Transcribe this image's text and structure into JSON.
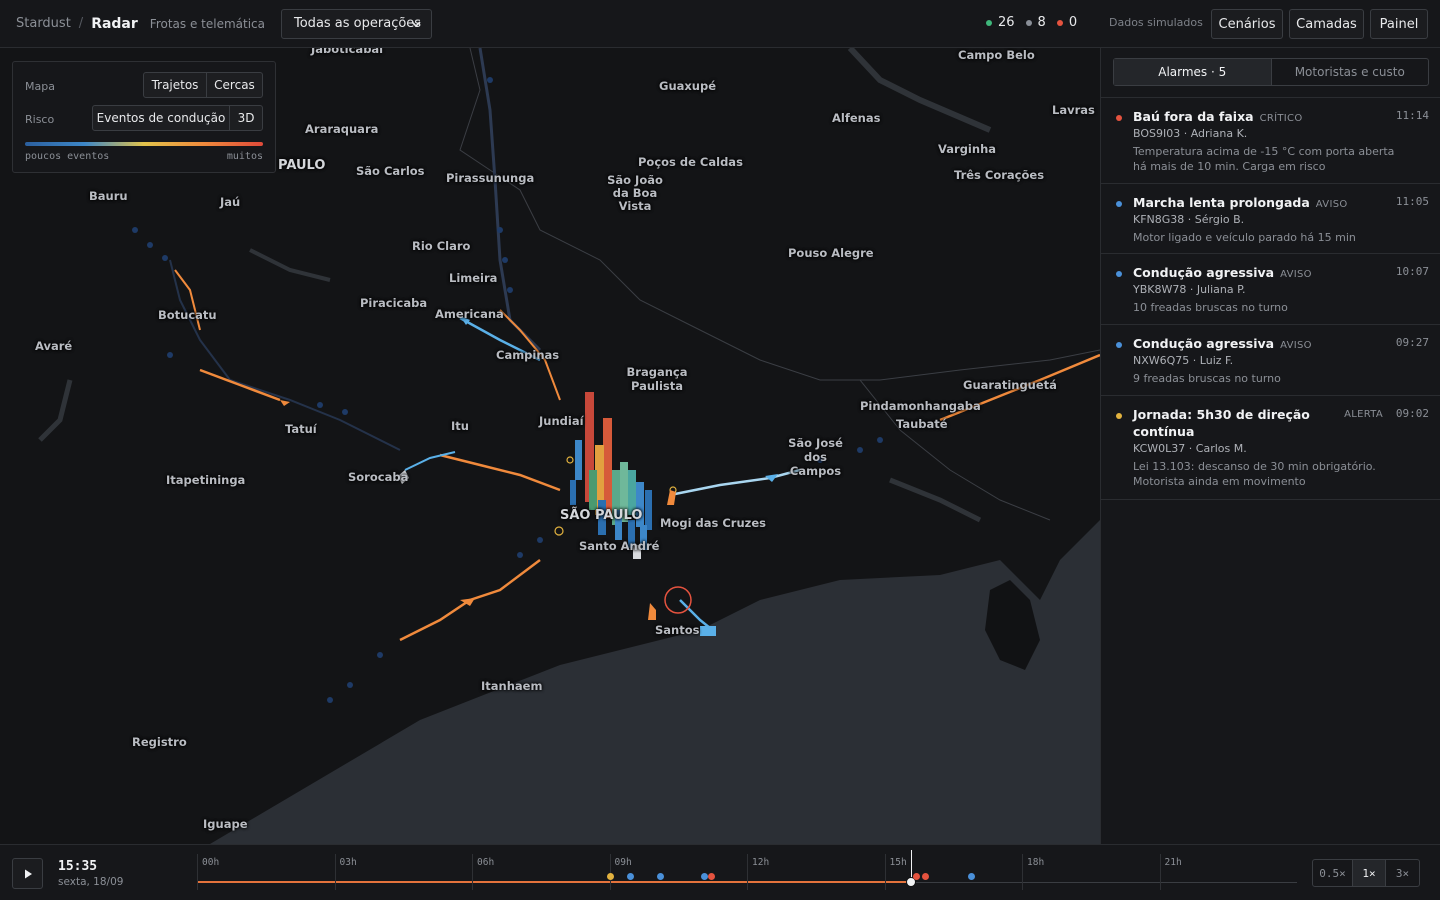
{
  "header": {
    "brand": "Stardust",
    "separator": "/",
    "app": "Radar",
    "subtitle": "Frotas e telemática",
    "operations_select": "Todas as operações",
    "counts": [
      {
        "value": "26",
        "color": "#3fb77b"
      },
      {
        "value": "8",
        "color": "#8a8f98"
      },
      {
        "value": "0",
        "color": "#e5533f"
      }
    ],
    "sim_label": "Dados simulados",
    "buttons": {
      "scenarios": "Cenários",
      "layers": "Camadas",
      "panel": "Painel"
    }
  },
  "map_panel": {
    "map_label": "Mapa",
    "map_options": [
      "Trajetos",
      "Cercas"
    ],
    "risk_label": "Risco",
    "risk_options": [
      "Eventos de condução",
      "3D"
    ],
    "scale_low": "poucos eventos",
    "scale_high": "muitos"
  },
  "cities": [
    "Jaboticabal",
    "Campo Belo",
    "Guaxupé",
    "Lavras",
    "Araraquara",
    "Alfenas",
    "PAULO",
    "São Carlos",
    "Poços de Caldas",
    "Varginha",
    "Pirassununga",
    "São João da Boa Vista",
    "Três Corações",
    "Bauru",
    "Jaú",
    "Rio Claro",
    "Pouso Alegre",
    "Limeira",
    "Piracicaba",
    "Botucatu",
    "Americana",
    "Avaré",
    "Campinas",
    "Bragança Paulista",
    "Guaratinguetá",
    "Pindamonhangaba",
    "Jundiaí",
    "Taubaté",
    "Tatuí",
    "Itu",
    "São José dos Campos",
    "Sorocaba",
    "Itapetininga",
    "SÃO PAULO",
    "Mogi das Cruzes",
    "Santo André",
    "Santos",
    "Itanhaem",
    "Registro",
    "Iguape"
  ],
  "side": {
    "tabs": [
      "Alarmes · 5",
      "Motoristas e custo"
    ],
    "alarms": [
      {
        "title": "Baú fora da faixa",
        "tag": "CRÍTICO",
        "time": "11:14",
        "vehicle": "BOS9I03 · Adriana K.",
        "desc": "Temperatura acima de -15 °C com porta aberta há mais de 10 min. Carga em risco",
        "color": "#e5533f"
      },
      {
        "title": "Marcha lenta prolongada",
        "tag": "AVISO",
        "time": "11:05",
        "vehicle": "KFN8G38 · Sérgio B.",
        "desc": "Motor ligado e veículo parado há 15 min",
        "color": "#4a90d9"
      },
      {
        "title": "Condução agressiva",
        "tag": "AVISO",
        "time": "10:07",
        "vehicle": "YBK8W78 · Juliana P.",
        "desc": "10 freadas bruscas no turno",
        "color": "#4a90d9"
      },
      {
        "title": "Condução agressiva",
        "tag": "AVISO",
        "time": "09:27",
        "vehicle": "NXW6Q75 · Luiz F.",
        "desc": "9 freadas bruscas no turno",
        "color": "#4a90d9"
      },
      {
        "title": "Jornada: 5h30 de direção contínua",
        "tag": "ALERTA",
        "time": "09:02",
        "vehicle": "KCW0L37 · Carlos M.",
        "desc": "Lei 13.103: descanso de 30 min obrigatório. Motorista ainda em movimento",
        "color": "#e2b23f"
      }
    ]
  },
  "timeline": {
    "time": "15:35",
    "date": "sexta, 18/09",
    "hours": [
      "00h",
      "03h",
      "06h",
      "09h",
      "12h",
      "15h",
      "18h",
      "21h"
    ],
    "progress_hours": 15.58,
    "events": [
      {
        "hour": 9.02,
        "color": "#e2b23f"
      },
      {
        "hour": 9.45,
        "color": "#4a90d9"
      },
      {
        "hour": 10.12,
        "color": "#4a90d9"
      },
      {
        "hour": 11.08,
        "color": "#4a90d9"
      },
      {
        "hour": 11.23,
        "color": "#e5533f"
      },
      {
        "hour": 15.7,
        "color": "#e5533f"
      },
      {
        "hour": 15.9,
        "color": "#e5533f"
      },
      {
        "hour": 16.9,
        "color": "#4a90d9"
      }
    ],
    "speeds": [
      "0.5×",
      "1×",
      "3×"
    ],
    "active_speed": "1×"
  }
}
